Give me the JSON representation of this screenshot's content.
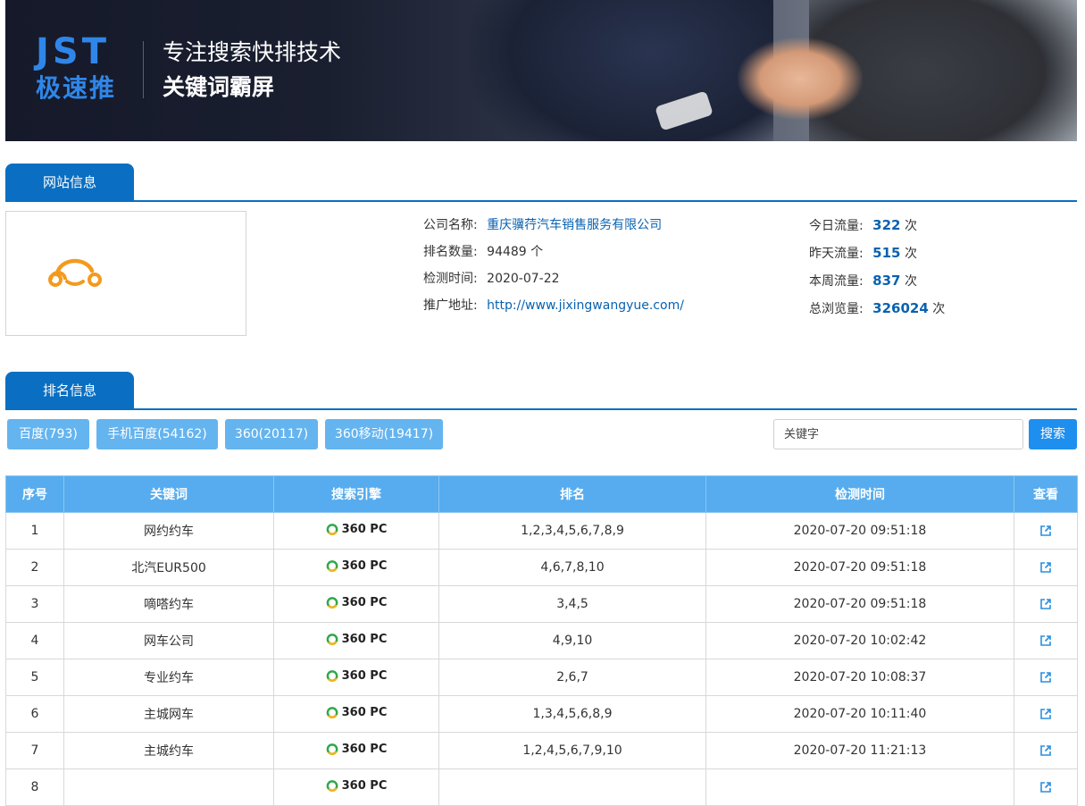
{
  "banner": {
    "logo_en": "JST",
    "logo_cn": "极速推",
    "slogan_line1": "专注搜索快排技术",
    "slogan_line2": "关键词霸屏"
  },
  "site_info": {
    "tab_label": "网站信息",
    "company_label": "公司名称:",
    "company_value": "重庆骥荇汽车销售服务有限公司",
    "rank_count_label": "排名数量:",
    "rank_count_value": "94489 个",
    "check_time_label": "检测时间:",
    "check_time_value": "2020-07-22",
    "promo_url_label": "推广地址:",
    "promo_url_value": "http://www.jixingwangyue.com/",
    "stats": [
      {
        "label": "今日流量:",
        "value": "322",
        "unit": "次"
      },
      {
        "label": "昨天流量:",
        "value": "515",
        "unit": "次"
      },
      {
        "label": "本周流量:",
        "value": "837",
        "unit": "次"
      },
      {
        "label": "总浏览量:",
        "value": "326024",
        "unit": "次"
      }
    ]
  },
  "ranking": {
    "tab_label": "排名信息",
    "filters": [
      "百度(793)",
      "手机百度(54162)",
      "360(20117)",
      "360移动(19417)"
    ],
    "search_placeholder": "关键字",
    "search_button": "搜索",
    "columns": [
      "序号",
      "关键词",
      "搜索引擎",
      "排名",
      "检测时间",
      "查看"
    ],
    "rows": [
      {
        "no": "1",
        "keyword": "网约约车",
        "engine": "360 PC",
        "rank": "1,2,3,4,5,6,7,8,9",
        "time": "2020-07-20 09:51:18"
      },
      {
        "no": "2",
        "keyword": "北汽EUR500",
        "engine": "360 PC",
        "rank": "4,6,7,8,10",
        "time": "2020-07-20 09:51:18"
      },
      {
        "no": "3",
        "keyword": "嘀嗒约车",
        "engine": "360 PC",
        "rank": "3,4,5",
        "time": "2020-07-20 09:51:18"
      },
      {
        "no": "4",
        "keyword": "网车公司",
        "engine": "360 PC",
        "rank": "4,9,10",
        "time": "2020-07-20 10:02:42"
      },
      {
        "no": "5",
        "keyword": "专业约车",
        "engine": "360 PC",
        "rank": "2,6,7",
        "time": "2020-07-20 10:08:37"
      },
      {
        "no": "6",
        "keyword": "主城网车",
        "engine": "360 PC",
        "rank": "1,3,4,5,6,8,9",
        "time": "2020-07-20 10:11:40"
      },
      {
        "no": "7",
        "keyword": "主城约车",
        "engine": "360 PC",
        "rank": "1,2,4,5,6,7,9,10",
        "time": "2020-07-20 11:21:13"
      },
      {
        "no": "8",
        "keyword": "",
        "engine": "360 PC",
        "rank": "",
        "time": ""
      }
    ]
  },
  "colors": {
    "primary": "#0a6fc2",
    "filter_button": "#64b4f0",
    "table_header": "#56acee",
    "logo_orange": "#f39a1e"
  }
}
